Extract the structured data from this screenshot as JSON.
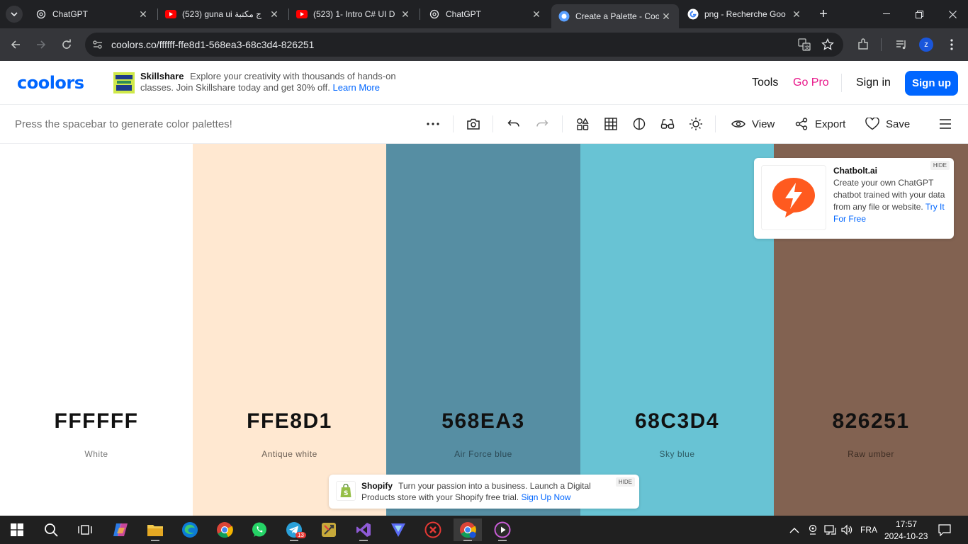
{
  "browser": {
    "tabs": [
      {
        "title": "ChatGPT",
        "icon": "chatgpt-icon"
      },
      {
        "title": "(523) guna ui ج مكتبة",
        "icon": "youtube-icon"
      },
      {
        "title": "(523) 1- Intro C# UI D",
        "icon": "youtube-icon"
      },
      {
        "title": "ChatGPT",
        "icon": "chatgpt-icon"
      },
      {
        "title": "Create a Palette - Coo",
        "icon": "coolors-icon"
      },
      {
        "title": "png - Recherche Goo",
        "icon": "google-icon"
      }
    ],
    "url": "coolors.co/ffffff-ffe8d1-568ea3-68c3d4-826251"
  },
  "header": {
    "logo": "coolors",
    "ad": {
      "brand": "Skillshare",
      "text": "Explore your creativity with thousands of hands-on classes. Join Skillshare today and get 30% off.",
      "link": "Learn More"
    },
    "nav": {
      "tools": "Tools",
      "gopro": "Go Pro",
      "signin": "Sign in",
      "signup": "Sign up"
    }
  },
  "toolbar": {
    "hint": "Press the spacebar to generate color palettes!",
    "view": "View",
    "export": "Export",
    "save": "Save"
  },
  "palette": [
    {
      "hex": "FFFFFF",
      "name": "White",
      "color": "#FFFFFF",
      "text": "#111111",
      "sub": "#777777"
    },
    {
      "hex": "FFE8D1",
      "name": "Antique white",
      "color": "#FFE8D1",
      "text": "#111111",
      "sub": "#6b5f55"
    },
    {
      "hex": "568EA3",
      "name": "Air Force blue",
      "color": "#568EA3",
      "text": "#111111",
      "sub": "#2c4a56"
    },
    {
      "hex": "68C3D4",
      "name": "Sky blue",
      "color": "#68C3D4",
      "text": "#111111",
      "sub": "#2f5e67"
    },
    {
      "hex": "826251",
      "name": "Raw umber",
      "color": "#826251",
      "text": "#111111",
      "sub": "#3d2d24"
    }
  ],
  "chatbolt_ad": {
    "title": "Chatbolt.ai",
    "text": "Create your own ChatGPT chatbot trained with your data from any file or website.",
    "link": "Try It For Free",
    "hide": "HIDE"
  },
  "shopify_ad": {
    "brand": "Shopify",
    "text": "Turn your passion into a business. Launch a Digital Products store with your Shopify free trial.",
    "link": "Sign Up Now",
    "hide": "HIDE"
  },
  "taskbar": {
    "lang": "FRA",
    "time": "17:57",
    "date": "2024-10-23",
    "telegram_badge": "13"
  }
}
